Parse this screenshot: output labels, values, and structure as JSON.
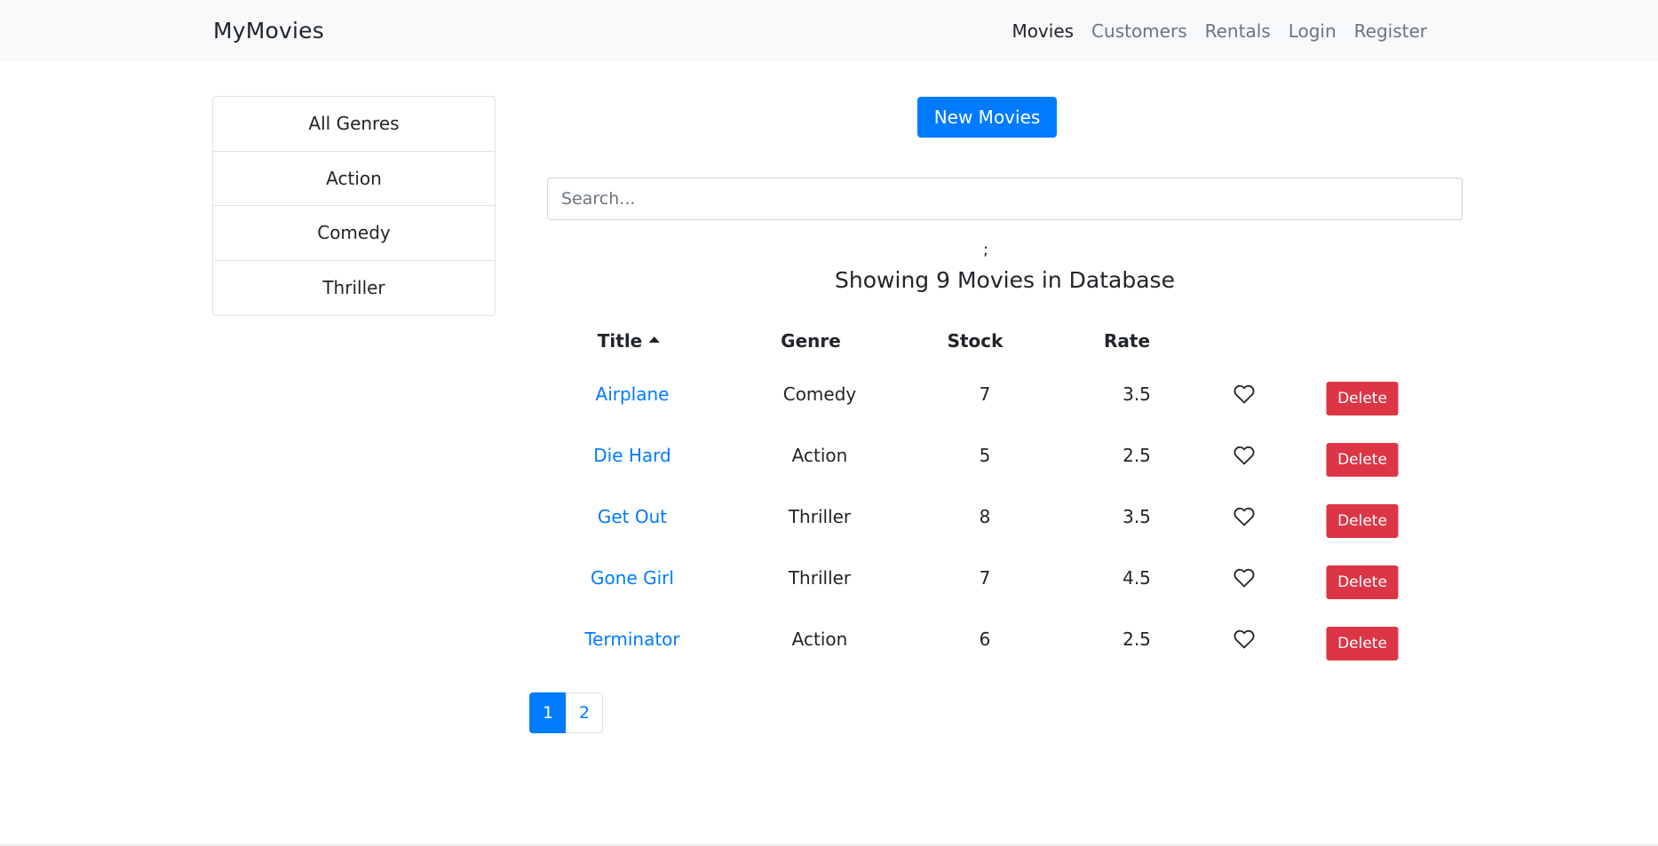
{
  "navbar": {
    "brand": "MyMovies",
    "links": [
      {
        "label": "Movies",
        "active": true
      },
      {
        "label": "Customers",
        "active": false
      },
      {
        "label": "Rentals",
        "active": false
      },
      {
        "label": "Login",
        "active": false
      },
      {
        "label": "Register",
        "active": false
      }
    ]
  },
  "genres": [
    "All Genres",
    "Action",
    "Comedy",
    "Thriller"
  ],
  "toolbar": {
    "new_movie_label": "New Movies"
  },
  "search": {
    "placeholder": "Search...",
    "value": ""
  },
  "stray_text": ";",
  "summary": "Showing 9 Movies in Database",
  "table": {
    "headers": {
      "title": "Title",
      "genre": "Genre",
      "stock": "Stock",
      "rate": "Rate"
    },
    "sort_column": "Title",
    "sort_direction": "asc",
    "delete_label": "Delete",
    "like_icon": "heart-outline-icon",
    "rows": [
      {
        "title": "Airplane",
        "genre": "Comedy",
        "stock": "7",
        "rate": "3.5"
      },
      {
        "title": "Die Hard",
        "genre": "Action",
        "stock": "5",
        "rate": "2.5"
      },
      {
        "title": "Get Out",
        "genre": "Thriller",
        "stock": "8",
        "rate": "3.5"
      },
      {
        "title": "Gone Girl",
        "genre": "Thriller",
        "stock": "7",
        "rate": "4.5"
      },
      {
        "title": "Terminator",
        "genre": "Action",
        "stock": "6",
        "rate": "2.5"
      }
    ]
  },
  "pagination": {
    "pages": [
      "1",
      "2"
    ],
    "current": "1"
  },
  "colors": {
    "primary": "#007bff",
    "danger": "#dc3545",
    "navbar_bg": "#f8f9fa",
    "muted": "#6c757d"
  }
}
